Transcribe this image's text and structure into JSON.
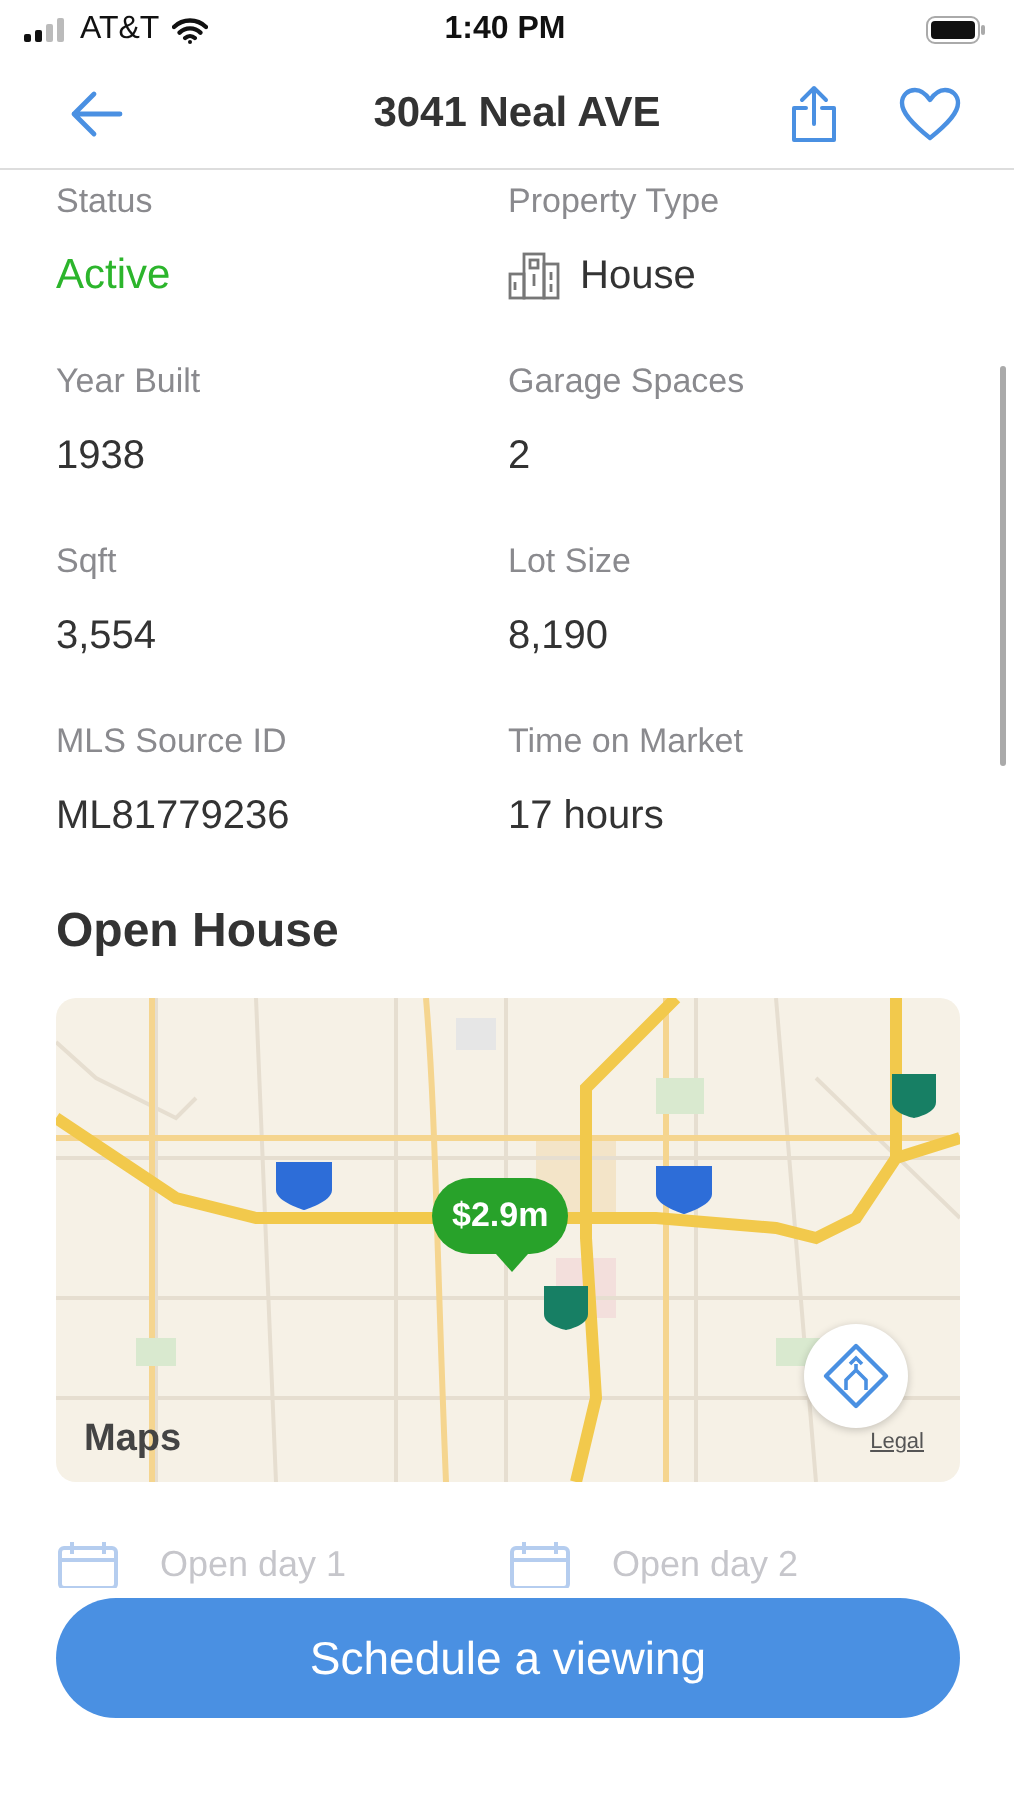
{
  "status_bar": {
    "carrier": "AT&T",
    "time": "1:40 PM"
  },
  "nav": {
    "title": "3041 Neal AVE",
    "favorite": false
  },
  "facts": [
    {
      "label": "Status",
      "value": "Active",
      "kind": "status"
    },
    {
      "label": "Property Type",
      "value": "House",
      "kind": "type"
    },
    {
      "label": "Year Built",
      "value": "1938",
      "kind": "plain"
    },
    {
      "label": "Garage Spaces",
      "value": "2",
      "kind": "plain"
    },
    {
      "label": "Sqft",
      "value": "3,554",
      "kind": "plain"
    },
    {
      "label": "Lot Size",
      "value": "8,190",
      "kind": "plain"
    },
    {
      "label": "MLS Source ID",
      "value": "ML81779236",
      "kind": "plain"
    },
    {
      "label": "Time on Market",
      "value": "17 hours",
      "kind": "plain"
    }
  ],
  "open_house": {
    "title": "Open House",
    "map": {
      "kind": "picture",
      "price_pin": "$2.9m",
      "attribution": "Maps",
      "legal": "Legal"
    },
    "days": [
      "Open day 1",
      "Open day 2"
    ]
  },
  "primary_button": "Schedule a viewing"
}
